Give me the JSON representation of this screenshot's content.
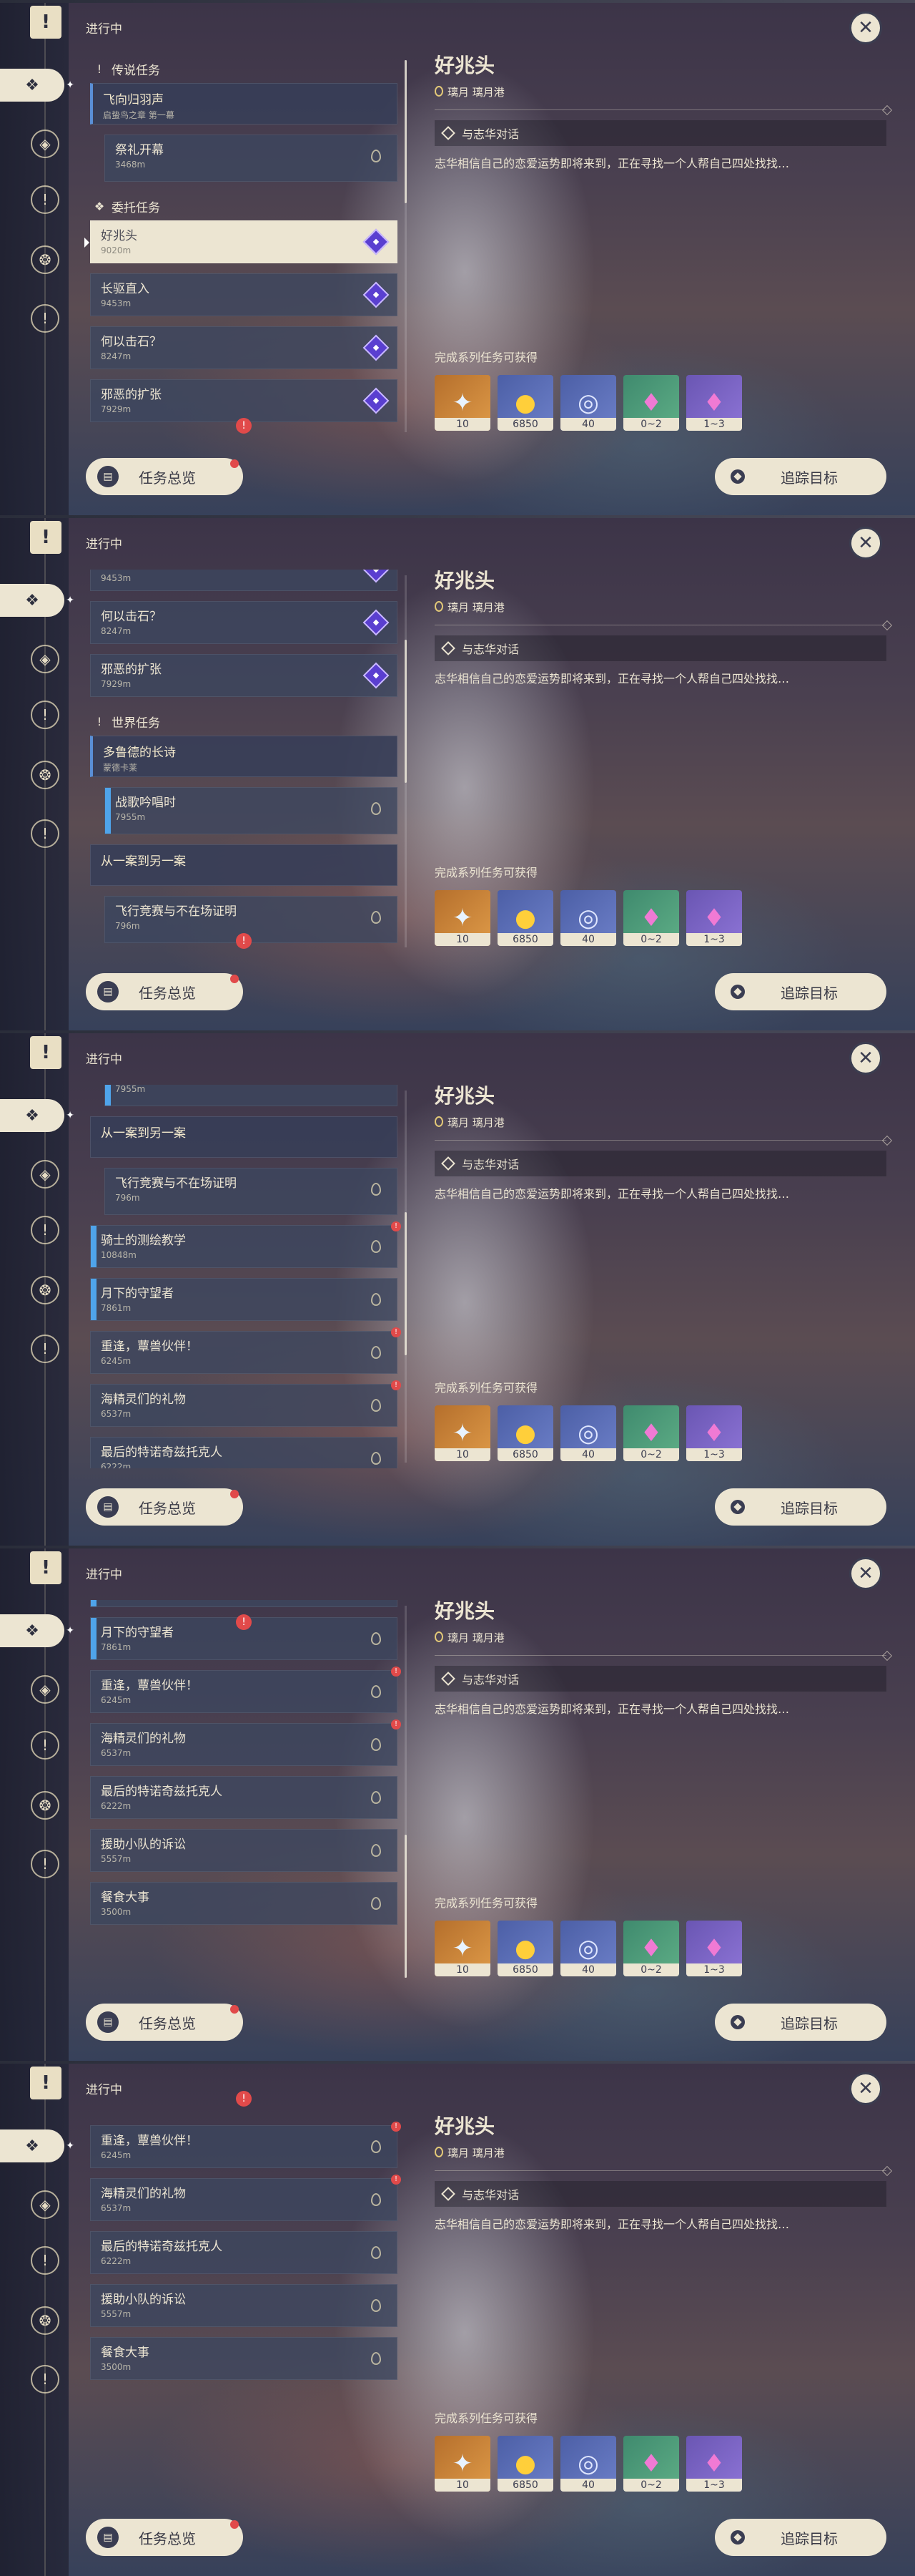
{
  "common": {
    "status": "进行中",
    "overview_label": "任务总览",
    "track_label": "追踪目标",
    "detail": {
      "title": "好兆头",
      "location": "璃月 璃月港",
      "objective": "与志华对话",
      "description": "志华相信自己的恋爱运势即将来到，正在寻找一个人帮自己四处找找…",
      "reward_label": "完成系列任务可获得",
      "rewards": [
        {
          "icon": "primogem-icon",
          "count": "10"
        },
        {
          "icon": "mora-icon",
          "count": "6850"
        },
        {
          "icon": "adventure-exp-icon",
          "count": "40"
        },
        {
          "icon": "crystal-green-icon",
          "count": "0~2"
        },
        {
          "icon": "crystal-purple-icon",
          "count": "1~3"
        }
      ]
    }
  },
  "categories": {
    "legend": "传说任务",
    "commission": "委托任务",
    "world": "世界任务"
  },
  "quests": {
    "feixiang": {
      "name": "飞向归羽声",
      "sub": "启蛰鸟之章 第一幕"
    },
    "jili": {
      "name": "祭礼开幕",
      "dist": "3468m"
    },
    "haozhaotou": {
      "name": "好兆头",
      "dist": "9020m"
    },
    "changqu": {
      "name": "长驱直入",
      "dist": "9453m"
    },
    "heyi": {
      "name": "何以击石？",
      "dist": "8247m"
    },
    "xiee": {
      "name": "邪恶的扩张",
      "dist": "7929m"
    },
    "duolude": {
      "name": "多鲁德的长诗",
      "sub": "蒙德卡莱"
    },
    "zhange": {
      "name": "战歌吟唱时",
      "dist": "7955m"
    },
    "congyian": {
      "name": "从一案到另一案"
    },
    "feixing": {
      "name": "飞行竞赛与不在场证明",
      "dist": "796m"
    },
    "qishi": {
      "name": "骑士的测绘教学",
      "dist": "10848m"
    },
    "yuexia": {
      "name": "月下的守望者",
      "dist": "7861m"
    },
    "chongfeng": {
      "name": "重逢，蕈兽伙伴！",
      "dist": "6245m"
    },
    "haijing": {
      "name": "海精灵们的礼物",
      "dist": "6537m"
    },
    "zuihou": {
      "name": "最后的特诺奇兹托克人",
      "dist": "6222m"
    },
    "yuanzhu": {
      "name": "援助小队的诉讼",
      "dist": "5557m"
    },
    "canshi": {
      "name": "餐食大事",
      "dist": "3500m"
    }
  }
}
